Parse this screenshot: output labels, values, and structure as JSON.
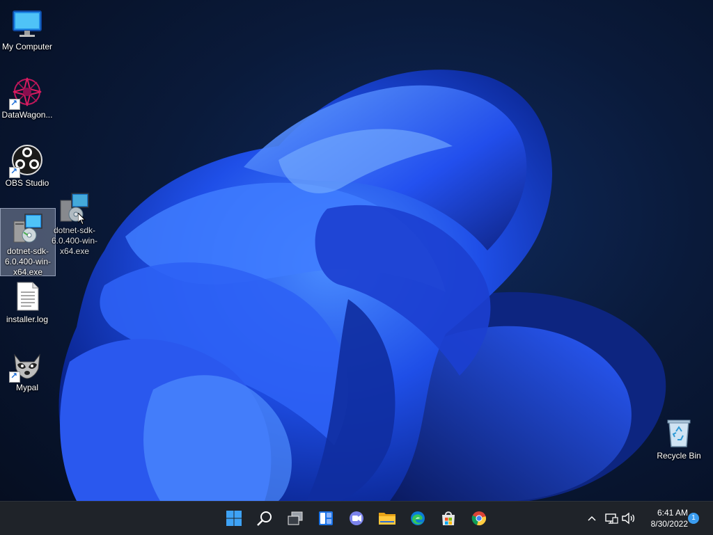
{
  "desktop": {
    "icons": [
      {
        "label": "My Computer",
        "icon": "monitor-icon"
      },
      {
        "label": "DataWagon...",
        "icon": "datawagon-icon",
        "shortcut": true
      },
      {
        "label": "OBS Studio",
        "icon": "obs-icon",
        "shortcut": true
      },
      {
        "label": "dotnet-sdk-6.0.400-win-x64.exe",
        "icon": "installer-icon",
        "selected": true
      },
      {
        "label": "installer.log",
        "icon": "text-file-icon"
      },
      {
        "label": "Mypal",
        "icon": "raccoon-icon",
        "shortcut": true
      }
    ],
    "drag_ghost": {
      "label": "dotnet-sdk-6.0.400-win-x64.exe",
      "icon": "installer-icon"
    },
    "recycle_bin": {
      "label": "Recycle Bin",
      "icon": "recycle-bin-icon"
    }
  },
  "taskbar": {
    "buttons": [
      {
        "name": "start",
        "icon": "windows-start-icon"
      },
      {
        "name": "search",
        "icon": "search-icon"
      },
      {
        "name": "task-view",
        "icon": "task-view-icon"
      },
      {
        "name": "widgets",
        "icon": "widgets-icon"
      },
      {
        "name": "chat",
        "icon": "teams-chat-icon"
      },
      {
        "name": "file-explorer",
        "icon": "folder-icon"
      },
      {
        "name": "edge",
        "icon": "edge-icon"
      },
      {
        "name": "store",
        "icon": "store-icon"
      },
      {
        "name": "chrome",
        "icon": "chrome-icon"
      }
    ],
    "tray": {
      "time": "6:41 AM",
      "date": "8/30/2022",
      "notification_count": "1"
    }
  },
  "colors": {
    "taskbar_bg": "#1f2329",
    "accent": "#3a9cf0",
    "wallpaper_blue": "#1e4bff"
  }
}
